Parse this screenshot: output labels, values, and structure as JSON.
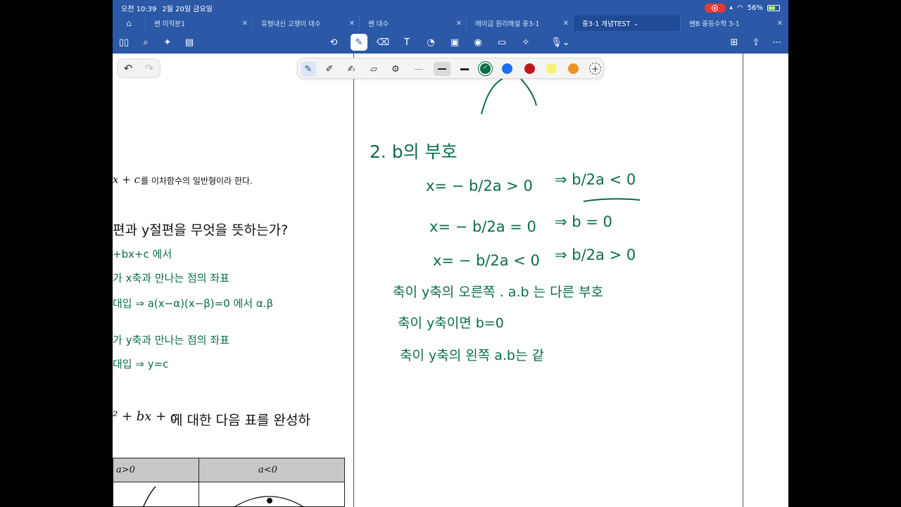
{
  "status_bar": {
    "time": "오전 10:39",
    "date": "2월 20일 금요일",
    "battery": "56%"
  },
  "tabs": [
    {
      "label": "쎈 미적분1",
      "active": false
    },
    {
      "label": "유형내신 고쟁이 대수",
      "active": false
    },
    {
      "label": "쎈 대수",
      "active": false
    },
    {
      "label": "에이급 원리해설 중3-1",
      "active": false
    },
    {
      "label": "중3-1 개념TEST",
      "active": true
    },
    {
      "label": "쎈B 중등수학 3-1",
      "active": false
    }
  ],
  "icons": {
    "home": "home-icon",
    "close": "close-icon",
    "chevron": "chevron-down-icon"
  },
  "pen_colors": [
    "#0a6d48",
    "#1e6ff2",
    "#c0161d",
    "#f8f27a",
    "#ef9226"
  ],
  "selected_color": "#0a6d48",
  "left_page": {
    "line1_math": "x + c",
    "line1_text": "를 이차함수의 일반형이라 한다.",
    "question": "편과 y절편을 무엇을 뜻하는가?",
    "ink": [
      "+bx+c 에서",
      "가  x축과 만나는 점의 좌표",
      "대입 ⇒ a(x−α)(x−β)=0 에서 α.β",
      "가 y축과 만나는 점의 좌표",
      "대입 ⇒ y=c"
    ],
    "task_math": "² + bx + c",
    "task_text": "에 대한 다음 표를 완성하",
    "table": {
      "left_header": "a>0",
      "right_header": "a<0"
    }
  },
  "right_page": {
    "heading": "2.  b의 부호",
    "rows": [
      {
        "lhs": "x= − b/2a > 0",
        "rhs": "⇒ b/2a < 0"
      },
      {
        "lhs": "x= − b/2a = 0",
        "rhs": "⇒ b = 0"
      },
      {
        "lhs": "x= − b/2a < 0",
        "rhs": "⇒ b/2a > 0"
      }
    ],
    "notes": [
      "축이 y축의 오른쪽 . a.b 는 다른 부호",
      "축이 y축이면        b=0",
      "축이 y축의 왼쪽     a.b는 같"
    ]
  }
}
